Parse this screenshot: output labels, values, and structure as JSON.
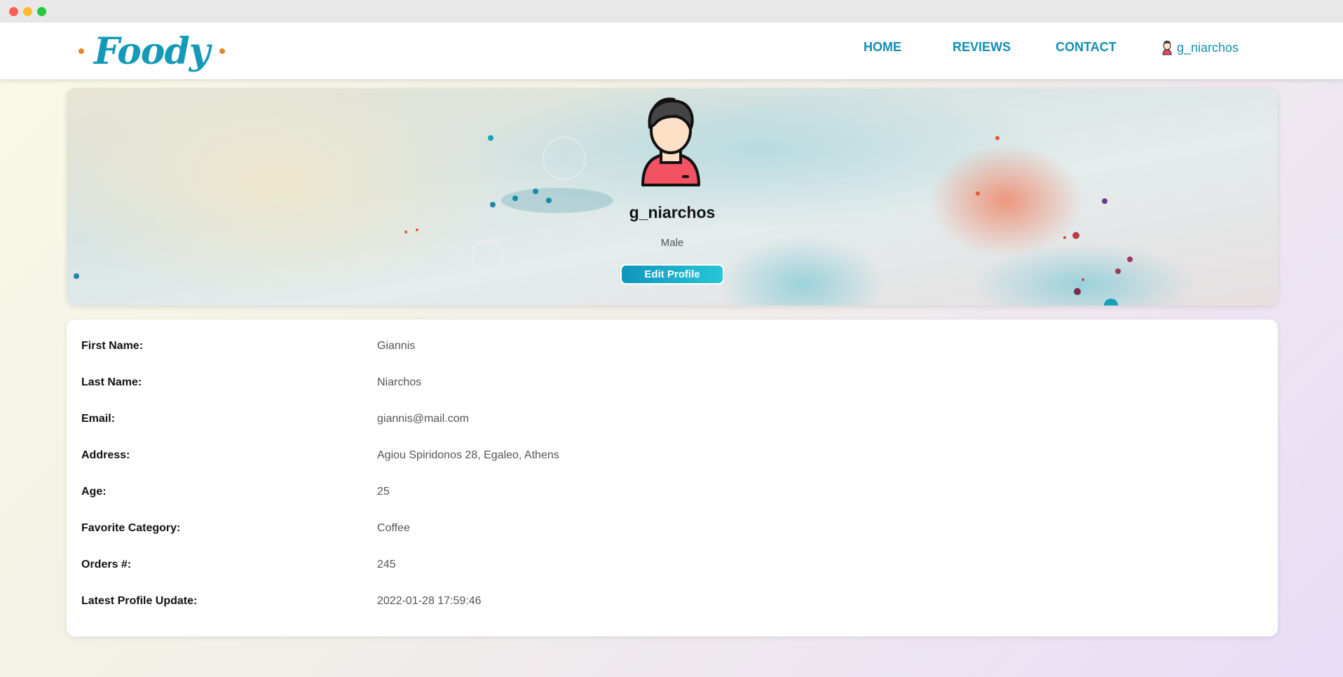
{
  "nav": {
    "logo": "Foody",
    "links": [
      "HOME",
      "REVIEWS",
      "CONTACT"
    ],
    "user": "g_niarchos",
    "link_color": "#128fb0"
  },
  "profile": {
    "username": "g_niarchos",
    "gender": "Male",
    "edit_button": "Edit Profile",
    "avatar_icon": "user-avatar-icon"
  },
  "details": [
    {
      "label": "First Name:",
      "value": "Giannis"
    },
    {
      "label": "Last Name:",
      "value": "Niarchos"
    },
    {
      "label": "Email:",
      "value": "giannis@mail.com"
    },
    {
      "label": "Address:",
      "value": "Agiou Spiridonos 28, Egaleo, Athens"
    },
    {
      "label": "Age:",
      "value": "25"
    },
    {
      "label": "Favorite Category:",
      "value": "Coffee"
    },
    {
      "label": "Orders #:",
      "value": "245"
    },
    {
      "label": "Latest Profile Update:",
      "value": "2022-01-28 17:59:46"
    }
  ],
  "colors": {
    "accent": "#1599b8",
    "logo_dot": "#e8852a",
    "button_start": "#0e96bd",
    "button_end": "#27c6d6"
  }
}
